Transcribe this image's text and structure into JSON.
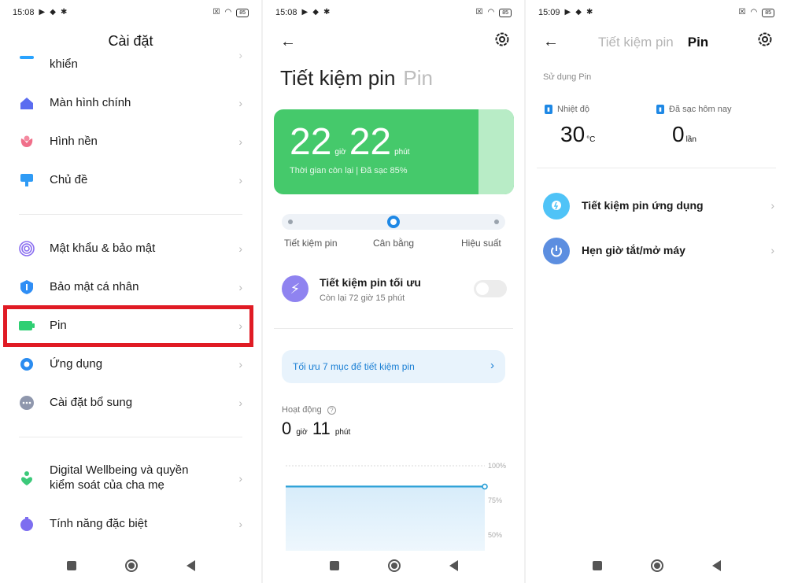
{
  "status": {
    "panel1_time": "15:08",
    "panel2_time": "15:08",
    "panel3_time": "15:09",
    "battery_level": "85"
  },
  "panel1": {
    "title": "Cài đặt",
    "items": [
      {
        "label": "khiển",
        "icon": "control-icon"
      },
      {
        "label": "Màn hình chính",
        "icon": "home-icon"
      },
      {
        "label": "Hình nền",
        "icon": "flower-icon"
      },
      {
        "label": "Chủ đề",
        "icon": "theme-icon"
      },
      {
        "label": "Mật khẩu & bảo mật",
        "icon": "fingerprint-icon"
      },
      {
        "label": "Bảo mật cá nhân",
        "icon": "privacy-icon"
      },
      {
        "label": "Pin",
        "icon": "battery-icon"
      },
      {
        "label": "Ứng dụng",
        "icon": "apps-gear-icon"
      },
      {
        "label": "Cài đặt bổ sung",
        "icon": "more-icon"
      },
      {
        "label": "Digital Wellbeing và quyền kiểm soát của cha mẹ",
        "icon": "wellbeing-icon"
      },
      {
        "label": "Tính năng đặc biệt",
        "icon": "special-icon"
      }
    ],
    "chevron": "›"
  },
  "panel2": {
    "title": "Tiết kiệm pin",
    "title_alt": "Pin",
    "battery_card": {
      "hours": "22",
      "hours_unit": "giờ",
      "minutes": "22",
      "minutes_unit": "phút",
      "subtitle": "Thời gian còn lại | Đã sạc 85%"
    },
    "modes": [
      "Tiết kiệm pin",
      "Cân bằng",
      "Hiệu suất"
    ],
    "selected_mode": "Cân bằng",
    "optimize": {
      "title": "Tiết kiệm pin tối ưu",
      "subtitle": "Còn lại 72 giờ 15 phút",
      "enabled": false
    },
    "tip": "Tối ưu 7 mục để tiết kiệm pin",
    "activity": {
      "label": "Hoạt động",
      "hours": "0",
      "hours_unit": "giờ",
      "minutes": "11",
      "minutes_unit": "phút"
    }
  },
  "panel3": {
    "tab1": "Tiết kiệm pin",
    "tab2": "Pin",
    "section": "Sử dụng Pin",
    "temp_label": "Nhiệt độ",
    "temp_value": "30",
    "temp_unit": "°C",
    "charge_label": "Đã sạc hôm nay",
    "charge_value": "0",
    "charge_unit": "lần",
    "rows": [
      {
        "label": "Tiết kiệm pin ứng dụng",
        "color": "#4fc3f7"
      },
      {
        "label": "Hẹn giờ tắt/mở máy",
        "color": "#5c8ee0"
      }
    ]
  },
  "chart_data": {
    "type": "area",
    "title": "",
    "x": [
      0,
      1
    ],
    "series": [
      {
        "values": [
          85,
          85
        ]
      }
    ],
    "ylim": [
      50,
      100
    ],
    "yticks": [
      "100%",
      "75%",
      "50%"
    ],
    "colors": {
      "line": "#2a9fd6",
      "fill": "#d7ecfa"
    }
  },
  "colors": {
    "accent_green": "#45c96b",
    "accent_blue": "#1e88e5",
    "highlight_red": "#e01b24"
  }
}
